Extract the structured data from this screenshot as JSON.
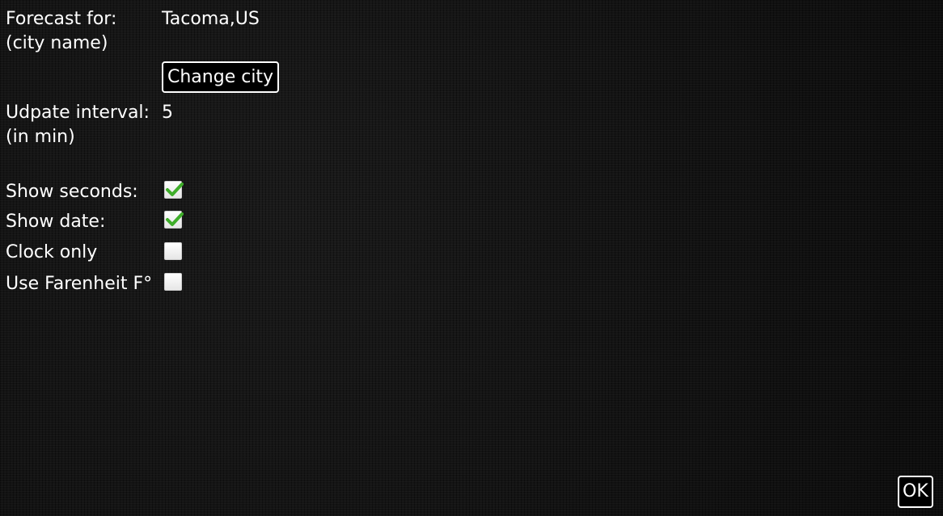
{
  "forecast": {
    "label_line1": "Forecast for:",
    "label_line2": "(city name)",
    "city_value": "Tacoma,US",
    "change_city_button": "Change city"
  },
  "update_interval": {
    "label_line1": "Udpate interval:",
    "label_line2": "(in min)",
    "value": "5"
  },
  "options": [
    {
      "label": "Show seconds:",
      "checked": true
    },
    {
      "label": "Show date:",
      "checked": true
    },
    {
      "label": "Clock only",
      "checked": false
    },
    {
      "label": "Use Farenheit F°",
      "checked": false
    }
  ],
  "ok_button": "OK",
  "colors": {
    "background": "#0e0e0e",
    "text": "#ffffff",
    "check_green": "#3fae2a"
  },
  "icons": {
    "checkbox_checked": "checkmark-icon"
  }
}
